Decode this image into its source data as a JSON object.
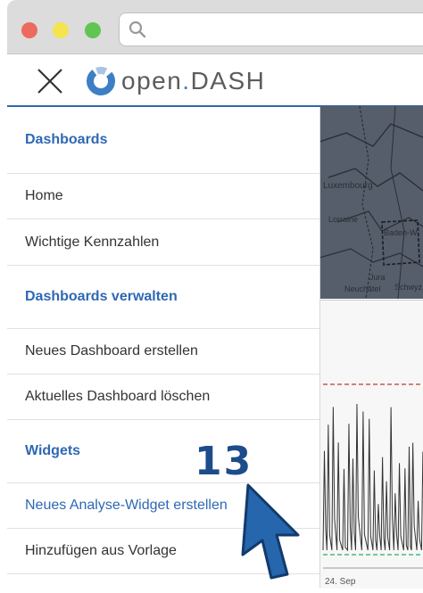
{
  "browser": {
    "url_value": "",
    "url_placeholder": ""
  },
  "header": {
    "logo_prefix": "open",
    "logo_dot": ".",
    "logo_suffix": "DASH"
  },
  "sidebar": {
    "items": [
      {
        "label": "Dashboards",
        "kind": "section"
      },
      {
        "label": "Home",
        "kind": "link"
      },
      {
        "label": "Wichtige Kennzahlen",
        "kind": "link"
      },
      {
        "label": "Dashboards verwalten",
        "kind": "section"
      },
      {
        "label": "Neues Dashboard erstellen",
        "kind": "link"
      },
      {
        "label": "Aktuelles Dashboard löschen",
        "kind": "link"
      },
      {
        "label": "Widgets",
        "kind": "section"
      },
      {
        "label": "Neues Analyse-Widget erstellen",
        "kind": "link",
        "active": true
      },
      {
        "label": "Hinzufügen aus Vorlage",
        "kind": "link"
      }
    ]
  },
  "annotation": {
    "step_number": "13"
  },
  "background": {
    "map_labels": [
      "Luxembourg",
      "Lorraine",
      "Baden-W",
      "Jura",
      "Neuchâtel",
      "Schwyz"
    ],
    "chart_date_label": "24. Sep"
  },
  "colors": {
    "accent": "#2f68b3",
    "badge": "#1d4c8a",
    "threshold_high": "#c0392b",
    "threshold_low": "#27ae60"
  }
}
